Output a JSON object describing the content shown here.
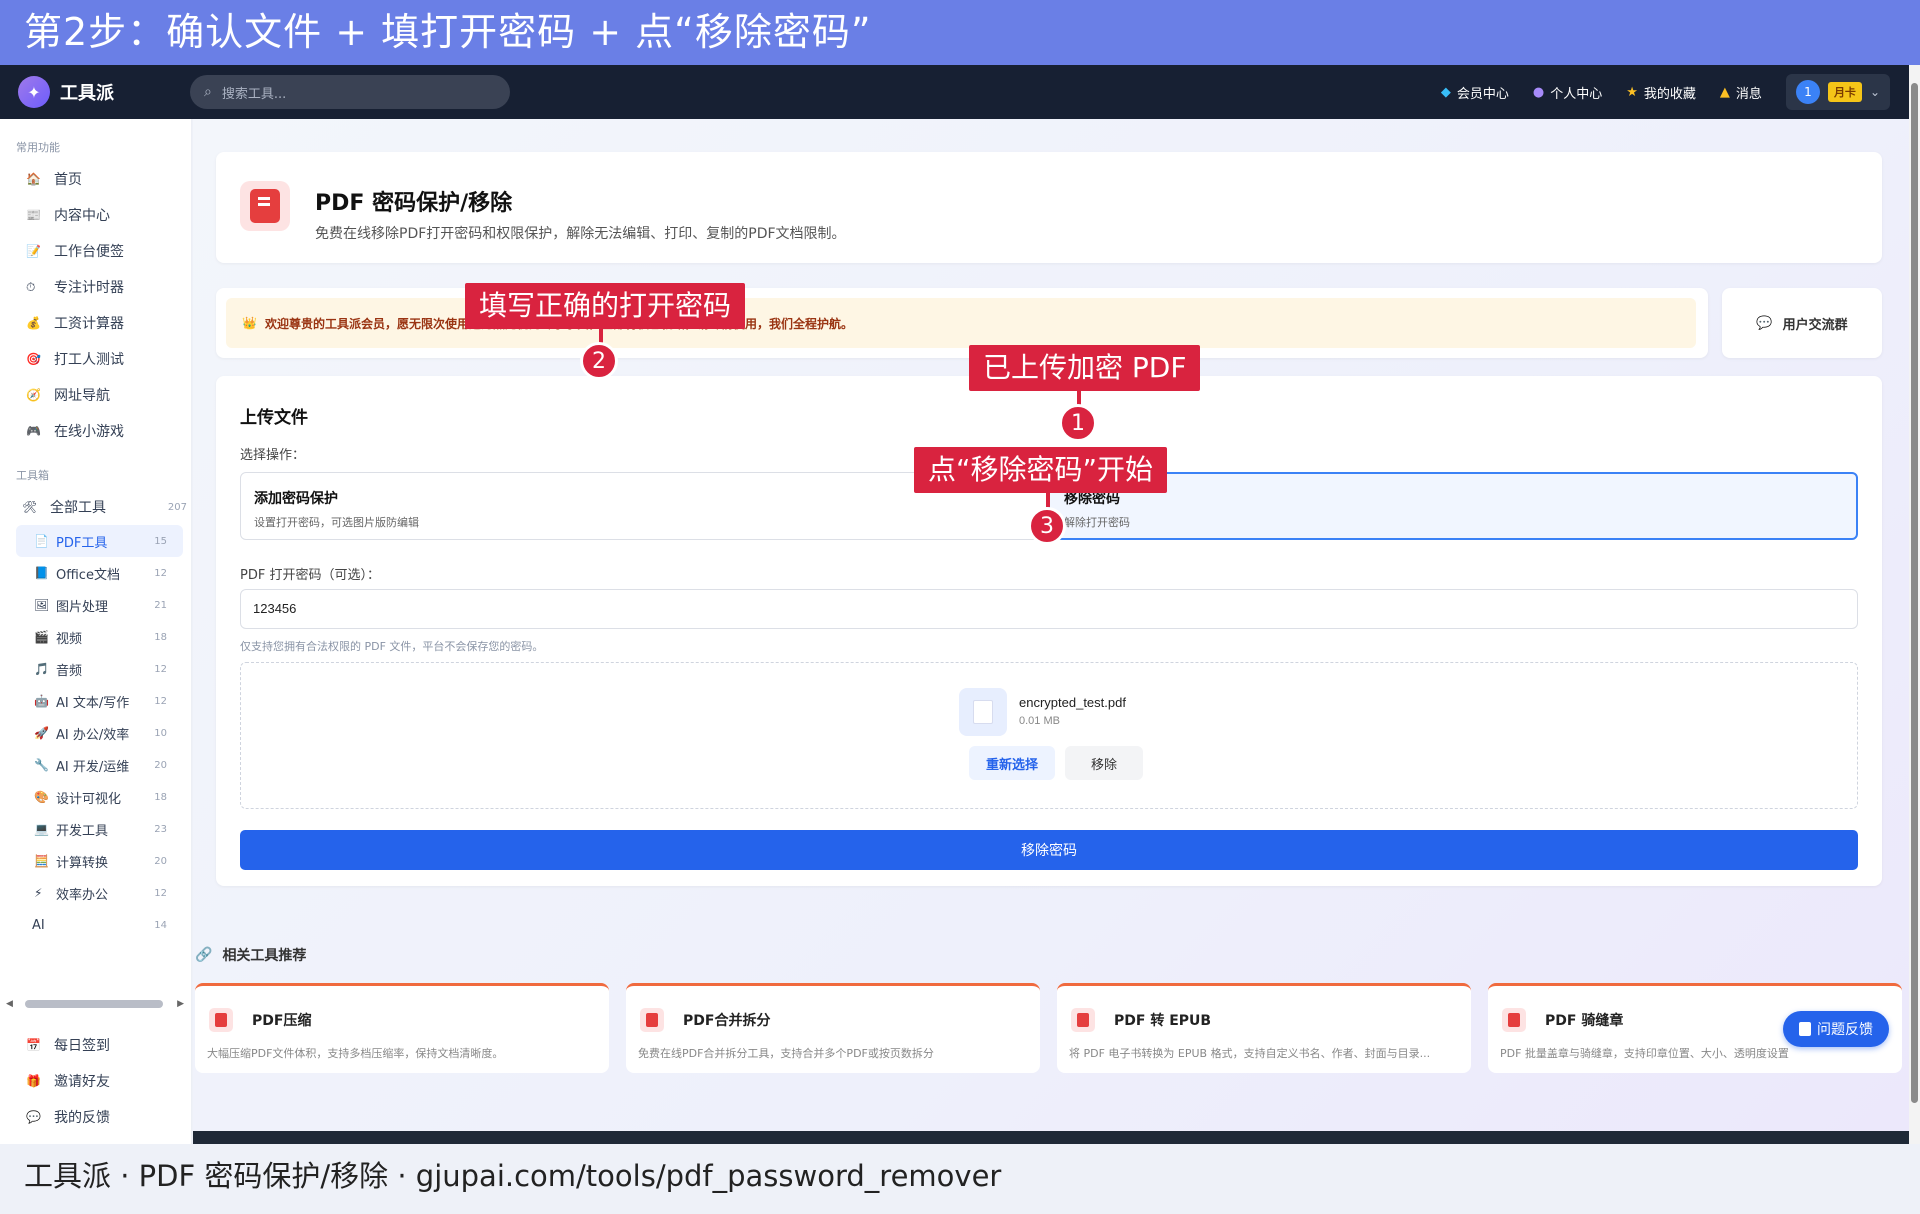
{
  "banner": "第2步：确认文件 + 填打开密码 + 点“移除密码”",
  "topbar": {
    "logo_text": "工具派",
    "search_placeholder": "搜索工具...",
    "nav": [
      {
        "label": "会员中心",
        "icon": "diamond-icon"
      },
      {
        "label": "个人中心",
        "icon": "user-icon"
      },
      {
        "label": "我的收藏",
        "icon": "star-icon"
      },
      {
        "label": "消息",
        "icon": "bell-icon"
      }
    ],
    "user_level": "1",
    "user_badge": "月卡"
  },
  "sidebar": {
    "section_common": "常用功能",
    "common": [
      "首页",
      "内容中心",
      "工作台便签",
      "专注计时器",
      "工资计算器",
      "打工人测试",
      "网址导航",
      "在线小游戏"
    ],
    "section_tools": "工具箱",
    "all_tools": {
      "label": "全部工具",
      "count": "207"
    },
    "categories": [
      {
        "label": "PDF工具",
        "count": "15"
      },
      {
        "label": "Office文档",
        "count": "12"
      },
      {
        "label": "图片处理",
        "count": "21"
      },
      {
        "label": "视频",
        "count": "18"
      },
      {
        "label": "音频",
        "count": "12"
      },
      {
        "label": "AI 文本/写作",
        "count": "12"
      },
      {
        "label": "AI 办公/效率",
        "count": "10"
      },
      {
        "label": "AI 开发/运维",
        "count": "20"
      },
      {
        "label": "设计可视化",
        "count": "18"
      },
      {
        "label": "开发工具",
        "count": "23"
      },
      {
        "label": "计算转换",
        "count": "20"
      },
      {
        "label": "效率办公",
        "count": "12"
      },
      {
        "label": "AI",
        "count": "14"
      }
    ],
    "bottom": [
      "每日签到",
      "邀请好友",
      "我的反馈"
    ]
  },
  "header": {
    "title": "PDF 密码保护/移除",
    "desc": "免费在线移除PDF打开密码和权限保护，解除无法编辑、打印、复制的PDF文档限制。"
  },
  "welcome": "欢迎尊贵的工具派会员，愿无限次使用这为照无忧的专享享受，全部特权已就绪，请尽情使用，我们全程护航。",
  "group_label": "用户交流群",
  "upload": {
    "title": "上传文件",
    "op_label": "选择操作：",
    "op_add_title": "添加密码保护",
    "op_add_sub": "设置打开密码，可选图片版防编辑",
    "op_remove_title": "移除密码",
    "op_remove_sub": "解除打开密码",
    "pw_label": "PDF 打开密码（可选）：",
    "pw_value": "123456",
    "pw_hint": "仅支持您拥有合法权限的 PDF 文件，平台不会保存您的密码。",
    "file_name": "encrypted_test.pdf",
    "file_size": "0.01 MB",
    "reselect": "重新选择",
    "remove": "移除",
    "action": "移除密码"
  },
  "related": {
    "title": "相关工具推荐",
    "items": [
      {
        "title": "PDF压缩",
        "desc": "大幅压缩PDF文件体积，支持多档压缩率，保持文档清晰度。"
      },
      {
        "title": "PDF合并拆分",
        "desc": "免费在线PDF合并拆分工具，支持合并多个PDF或按页数拆分"
      },
      {
        "title": "PDF 转 EPUB",
        "desc": "将 PDF 电子书转换为 EPUB 格式，支持自定义书名、作者、封面与目录..."
      },
      {
        "title": "PDF 骑缝章",
        "desc": "PDF 批量盖章与骑缝章，支持印章位置、大小、透明度设置"
      }
    ]
  },
  "feedback": "问题反馈",
  "annotations": {
    "a1": "已上传加密 PDF",
    "a2": "填写正确的打开密码",
    "a3": "点“移除密码”开始",
    "n1": "1",
    "n2": "2",
    "n3": "3"
  },
  "footer": "工具派 · PDF 密码保护/移除 · gjupai.com/tools/pdf_password_remover",
  "colors": {
    "accent": "#2563eb",
    "annotation": "#d9233f",
    "banner": "#6a7fe6",
    "topbar": "#172033"
  }
}
